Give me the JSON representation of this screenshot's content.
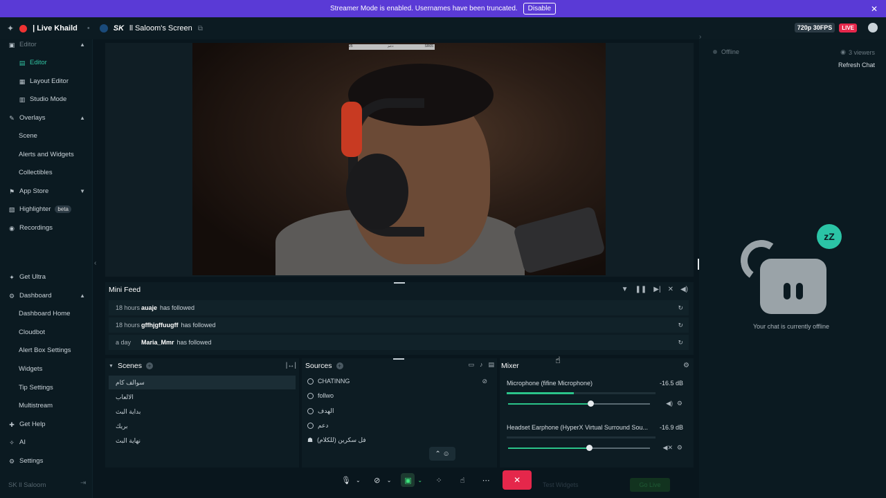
{
  "banner": {
    "text": "Streamer Mode is enabled. Usernames have been truncated.",
    "disable_label": "Disable",
    "close_glyph": "✕"
  },
  "titlebar": {
    "live_title": "| Live Khaild",
    "screen_prefix": "SK",
    "screen_title": "ll Saloom's Screen",
    "quality": "720p 30FPS",
    "live_badge": "LIVE"
  },
  "sidebar": {
    "editor_group": "Editor",
    "items": [
      {
        "label": "Editor"
      },
      {
        "label": "Layout Editor"
      },
      {
        "label": "Studio Mode"
      },
      {
        "label": "Overlays"
      },
      {
        "label": "Scene"
      },
      {
        "label": "Alerts and Widgets"
      },
      {
        "label": "Collectibles"
      },
      {
        "label": "App Store"
      },
      {
        "label": "Highlighter"
      },
      {
        "label": "Recordings"
      },
      {
        "label": "Get Ultra"
      },
      {
        "label": "Dashboard"
      },
      {
        "label": "Dashboard Home"
      },
      {
        "label": "Cloudbot"
      },
      {
        "label": "Alert Box Settings"
      },
      {
        "label": "Widgets"
      },
      {
        "label": "Tip Settings"
      },
      {
        "label": "Multistream"
      },
      {
        "label": "Get Help"
      },
      {
        "label": "AI"
      },
      {
        "label": "Settings"
      }
    ],
    "beta_label": "beta",
    "footer_user": "SK ll Saloom"
  },
  "preview": {
    "overlay_left": "25",
    "overlay_mid": "دعم",
    "overlay_right": "SR05"
  },
  "mini_feed": {
    "title": "Mini Feed",
    "rows": [
      {
        "time": "18 hours",
        "user": "auaje",
        "action": "has followed"
      },
      {
        "time": "18 hours",
        "user": "gffhjgffuugff",
        "action": "has followed"
      },
      {
        "time": "a day",
        "user": "Maria_Mmr",
        "action": "has followed"
      }
    ]
  },
  "scenes": {
    "title": "Scenes",
    "items": [
      "سوالف كام",
      "الالعاب",
      "بداية البث",
      "بريك",
      "نهاية البث"
    ],
    "selected_index": 0
  },
  "sources": {
    "title": "Sources",
    "items": [
      "CHATINNG",
      "follwo",
      "الهدف",
      "دعم",
      "فل سكرين (للكلام)"
    ]
  },
  "mixer": {
    "title": "Mixer",
    "channels": [
      {
        "name": "Microphone (fifine Microphone)",
        "db": "-16.5 dB",
        "level": 0.45,
        "volume": 0.58
      },
      {
        "name": "Headset Earphone (HyperX Virtual Surround Sou...",
        "db": "-16.9 dB",
        "level": 0.0,
        "volume": 0.57
      }
    ]
  },
  "bottom_toolbar": {
    "test_widgets": "Test Widgets",
    "go_live": "Go Live"
  },
  "chat": {
    "status": "Offline",
    "viewers": "3 viewers",
    "refresh": "Refresh Chat",
    "offline_message": "Your chat is currently offline",
    "badge": "zZ"
  },
  "colors": {
    "accent": "#31c3a2",
    "banner": "#5a3ad6",
    "live": "#e5274b",
    "background": "#09161d"
  }
}
